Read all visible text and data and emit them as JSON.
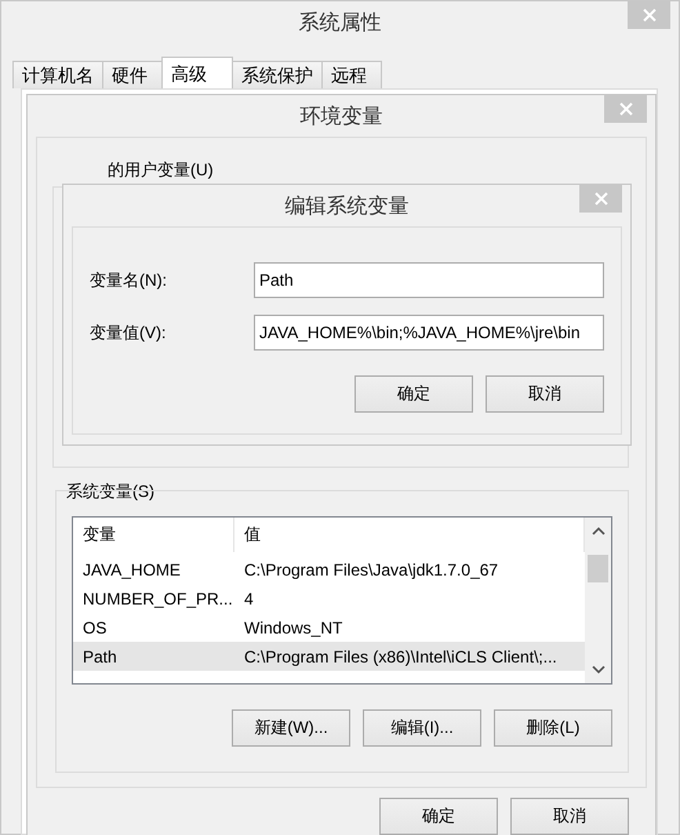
{
  "system_properties": {
    "title": "系统属性",
    "tabs": [
      {
        "label": "计算机名",
        "selected": false
      },
      {
        "label": "硬件",
        "selected": false
      },
      {
        "label": "高级",
        "selected": true
      },
      {
        "label": "系统保护",
        "selected": false
      },
      {
        "label": "远程",
        "selected": false
      }
    ],
    "buttons": [
      "确定",
      "取消"
    ]
  },
  "environment_variables": {
    "title": "环境变量",
    "user_variables_label": "的用户变量(U)",
    "system_variables_label": "系统变量(S)",
    "columns": [
      "变量",
      "值"
    ],
    "rows": [
      {
        "name": "JAVA_HOME",
        "value": "C:\\Program Files\\Java\\jdk1.7.0_67",
        "selected": false
      },
      {
        "name": "NUMBER_OF_PR...",
        "value": "4",
        "selected": false
      },
      {
        "name": "OS",
        "value": "Windows_NT",
        "selected": false
      },
      {
        "name": "Path",
        "value": "C:\\Program Files (x86)\\Intel\\iCLS Client\\;...",
        "selected": true
      }
    ],
    "buttons": [
      "新建(W)...",
      "编辑(I)...",
      "删除(L)"
    ]
  },
  "edit_system_variable": {
    "title": "编辑系统变量",
    "fields": [
      {
        "label": "变量名(N):",
        "value": "Path"
      },
      {
        "label": "变量值(V):",
        "value": "JAVA_HOME%\\bin;%JAVA_HOME%\\jre\\bin"
      }
    ],
    "buttons": [
      "确定",
      "取消"
    ]
  }
}
